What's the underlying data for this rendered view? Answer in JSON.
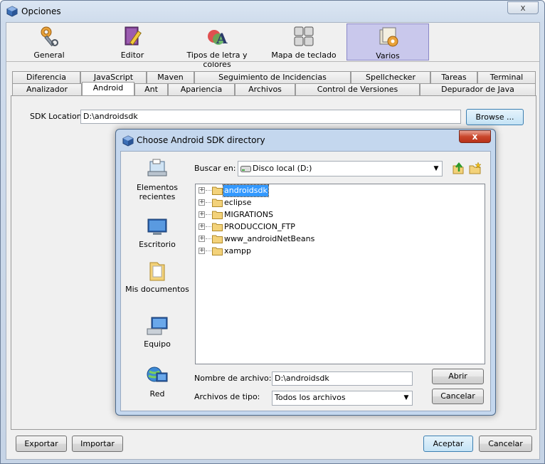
{
  "window": {
    "title": "Opciones",
    "close": "x"
  },
  "categories": [
    {
      "label": "General",
      "icon": "wrench-gear-icon"
    },
    {
      "label": "Editor",
      "icon": "pencil-book-icon"
    },
    {
      "label": "Tipos de letra y colores",
      "icon": "font-colors-icon"
    },
    {
      "label": "Mapa de teclado",
      "icon": "keyboard-icon"
    },
    {
      "label": "Varios",
      "icon": "misc-gear-icon",
      "selected": true
    }
  ],
  "tabs_row1": [
    "Diferencia",
    "JavaScript",
    "Maven",
    "Seguimiento de Incidencias",
    "Spellchecker",
    "Tareas",
    "Terminal"
  ],
  "tabs_row2": [
    "Analizador",
    "Android",
    "Ant",
    "Apariencia",
    "Archivos",
    "Control de Versiones",
    "Depurador de Java"
  ],
  "selected_tab": "Android",
  "sdk": {
    "label": "SDK Location:",
    "value": "D:\\androidsdk",
    "browse": "Browse ..."
  },
  "dialog": {
    "title": "Choose Android SDK directory",
    "close": "x",
    "look_in_label": "Buscar en:",
    "look_in_value": "Disco local (D:)",
    "places": [
      "Elementos recientes",
      "Escritorio",
      "Mis documentos",
      "Equipo",
      "Red"
    ],
    "folders": [
      "androidsdk",
      "eclipse",
      "MIGRATIONS",
      "PRODUCCION_FTP",
      "www_androidNetBeans",
      "xampp"
    ],
    "selected_folder": "androidsdk",
    "filename_label": "Nombre de archivo:",
    "filename_value": "D:\\androidsdk",
    "filetype_label": "Archivos de tipo:",
    "filetype_value": "Todos los archivos",
    "open": "Abrir",
    "cancel": "Cancelar"
  },
  "footer": {
    "export": "Exportar",
    "import": "Importar",
    "accept": "Aceptar",
    "cancel": "Cancelar"
  }
}
